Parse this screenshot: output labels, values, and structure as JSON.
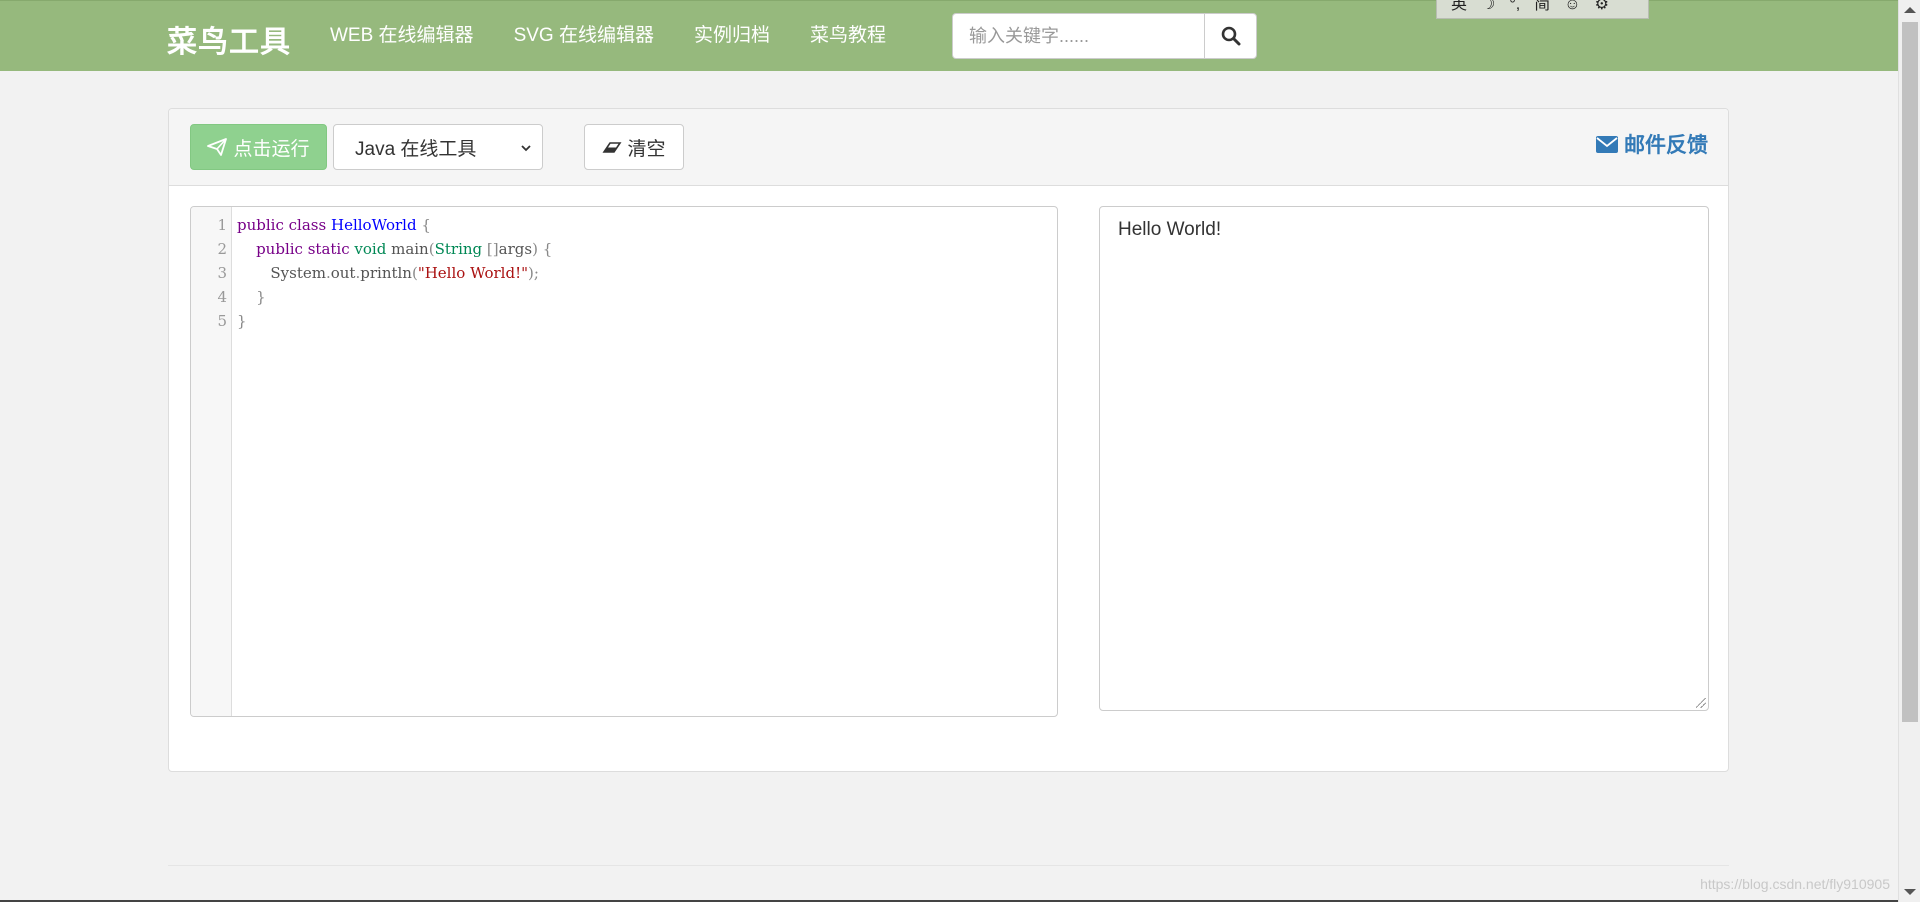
{
  "header": {
    "brand": "菜鸟工具",
    "nav": [
      {
        "label": "WEB 在线编辑器"
      },
      {
        "label": "SVG 在线编辑器"
      },
      {
        "label": "实例归档"
      },
      {
        "label": "菜鸟教程"
      }
    ],
    "search": {
      "placeholder": "输入关键字......",
      "value": "",
      "icon": "search-icon"
    }
  },
  "ime_toolbar": [
    "英",
    "☽",
    "°,",
    "简",
    "☺",
    "⚙"
  ],
  "toolbar": {
    "run_label": "点击运行",
    "language_selected": "Java 在线工具",
    "clear_label": "清空",
    "feedback_label": "邮件反馈"
  },
  "editor": {
    "line_numbers": [
      "1",
      "2",
      "3",
      "4",
      "5"
    ]
  },
  "output": {
    "text": "Hello World!"
  },
  "watermark": "https://blog.csdn.net/fly910905",
  "colors": {
    "header_bg": "#96b97d",
    "run_button": "#8fd18f",
    "link_blue": "#337ab7",
    "keyword": "#770088",
    "type": "#008855",
    "string": "#aa1111"
  }
}
